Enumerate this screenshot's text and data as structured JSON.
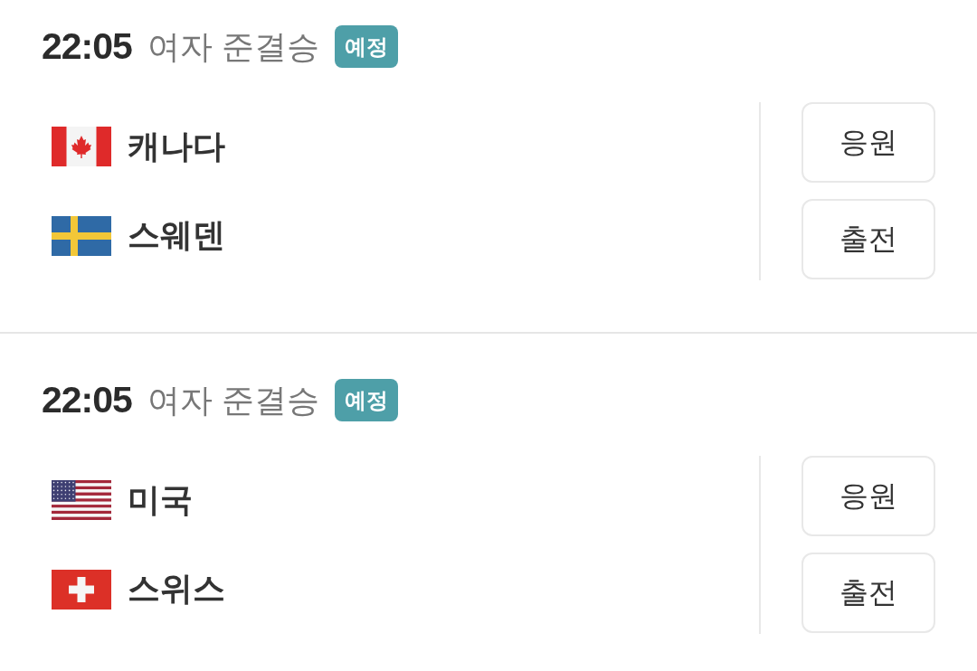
{
  "matches": [
    {
      "time": "22:05",
      "title": "여자 준결승",
      "badge": "예정",
      "teams": [
        {
          "name": "캐나다",
          "kind": "canada"
        },
        {
          "name": "스웨덴",
          "kind": "sweden"
        }
      ],
      "buttons": [
        "응원",
        "출전"
      ]
    },
    {
      "time": "22:05",
      "title": "여자 준결승",
      "badge": "예정",
      "teams": [
        {
          "name": "미국",
          "kind": "usa"
        },
        {
          "name": "스위스",
          "kind": "swiss"
        }
      ],
      "buttons": [
        "응원",
        "출전"
      ]
    }
  ]
}
